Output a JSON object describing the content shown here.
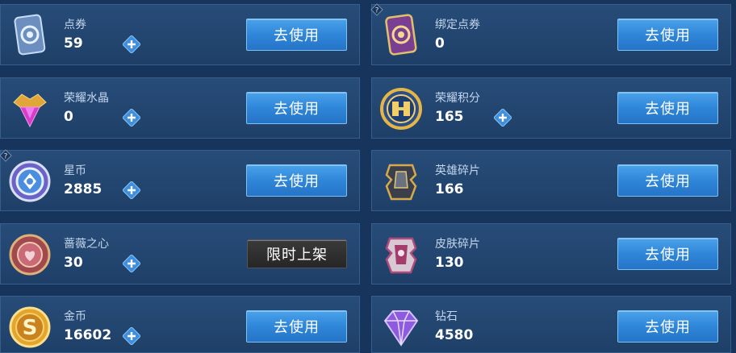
{
  "cards": [
    {
      "name": "点券",
      "value": "59",
      "button": "去使用",
      "icon": "ticket-icon",
      "has_plus": true,
      "has_help": false
    },
    {
      "name": "绑定点券",
      "value": "0",
      "button": "去使用",
      "icon": "bound-ticket-icon",
      "has_plus": false,
      "has_help": true
    },
    {
      "name": "荣耀水晶",
      "value": "0",
      "button": "去使用",
      "icon": "glory-crystal-icon",
      "has_plus": true,
      "has_help": false
    },
    {
      "name": "荣耀积分",
      "value": "165",
      "button": "去使用",
      "icon": "glory-points-icon",
      "has_plus": true,
      "has_help": false
    },
    {
      "name": "星币",
      "value": "2885",
      "button": "去使用",
      "icon": "star-coin-icon",
      "has_plus": true,
      "has_help": true
    },
    {
      "name": "英雄碎片",
      "value": "166",
      "button": "去使用",
      "icon": "hero-fragment-icon",
      "has_plus": false,
      "has_help": false
    },
    {
      "name": "蔷薇之心",
      "value": "30",
      "button": "限时上架",
      "icon": "rose-heart-icon",
      "has_plus": true,
      "has_help": false
    },
    {
      "name": "皮肤碎片",
      "value": "130",
      "button": "去使用",
      "icon": "skin-fragment-icon",
      "has_plus": false,
      "has_help": false
    },
    {
      "name": "金币",
      "value": "16602",
      "button": "去使用",
      "icon": "gold-coin-icon",
      "has_plus": true,
      "has_help": false
    },
    {
      "name": "钻石",
      "value": "4580",
      "button": "去使用",
      "icon": "diamond-icon",
      "has_plus": false,
      "has_help": false
    }
  ],
  "colors": {
    "accent": "#2f86d9",
    "panel": "#22456f",
    "plus": "#3f8fdc"
  }
}
